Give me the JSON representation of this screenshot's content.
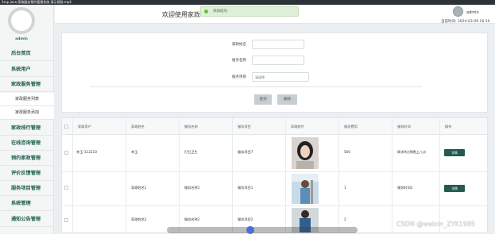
{
  "window": {
    "title": "2scp java 家政服务预约管理系统 演示视频.mp4"
  },
  "sidebar": {
    "admin_label": "admin",
    "items": [
      {
        "label": "后台首页"
      },
      {
        "label": "系统用户"
      },
      {
        "label": "家政服务管理"
      },
      {
        "label": "家政服务列表"
      },
      {
        "label": "家政服务添加"
      },
      {
        "label": "家政排行管理"
      },
      {
        "label": "在线咨询管理"
      },
      {
        "label": "预约家政管理"
      },
      {
        "label": "评价反馈管理"
      },
      {
        "label": "服务项目管理"
      },
      {
        "label": "系统管理"
      },
      {
        "label": "通知公告管理"
      }
    ]
  },
  "header": {
    "welcome": "欢迎使用家政",
    "user": "admin",
    "time_label": "当前时间: 2024-03-09 16:10"
  },
  "toast": {
    "message": "添加成功"
  },
  "search": {
    "fields": [
      {
        "label": "家政姓名",
        "value": "",
        "placeholder": ""
      },
      {
        "label": "服务名称",
        "value": "",
        "placeholder": ""
      },
      {
        "label": "服务项目",
        "value": "",
        "placeholder": "请选择"
      }
    ],
    "query_label": "查询",
    "delete_label": "删除"
  },
  "table": {
    "headers": [
      "",
      "家政用户",
      "家政姓名",
      "服务名称",
      "服务项目",
      "家政照片",
      "服务费用",
      "服务时间",
      "操作"
    ],
    "rows": [
      {
        "user": "李玉-112233",
        "name": "李玉",
        "service": "打扫卫生",
        "item": "服务项目7",
        "fee": "500",
        "time": "周末9点到晚上八点",
        "action": "详情"
      },
      {
        "user": "",
        "name": "家政姓名1",
        "service": "服务名称1",
        "item": "服务项目1",
        "fee": "1",
        "time": "服务时间1",
        "action": "详情"
      },
      {
        "user": "",
        "name": "家政姓名2",
        "service": "服务名称2",
        "item": "服务项目2",
        "fee": "2",
        "time": "",
        "action": ""
      }
    ]
  },
  "watermark": "CSDN @weixin_ZYK1985",
  "colors": {
    "accent": "#1b5e4d",
    "button": "#c8cdd0",
    "detail_button": "#245a4f",
    "toast_bg": "#dff0d8"
  }
}
